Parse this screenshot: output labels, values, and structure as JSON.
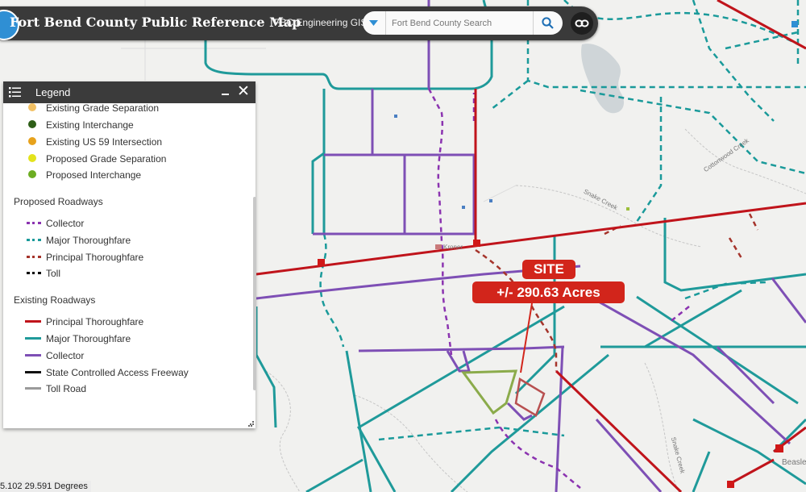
{
  "header": {
    "title": "Fort Bend County Public Reference Map",
    "subtitle": "FBC Engineering GIS",
    "search_placeholder": "Fort Bend County Search"
  },
  "legend": {
    "title": "Legend",
    "point_items": [
      {
        "label": "Existing Grade Separation",
        "color": "#f2c063"
      },
      {
        "label": "Existing Interchange",
        "color": "#2e5e18"
      },
      {
        "label": "Existing US 59 Intersection",
        "color": "#e7a21c"
      },
      {
        "label": "Proposed Grade Separation",
        "color": "#e3e31c"
      },
      {
        "label": "Proposed Interchange",
        "color": "#6cad22"
      }
    ],
    "proposed_heading": "Proposed Roadways",
    "proposed_items": [
      {
        "label": "Collector",
        "color": "#8b33b0"
      },
      {
        "label": "Major Thoroughfare",
        "color": "#1a9a9a"
      },
      {
        "label": "Principal Thoroughfare",
        "color": "#a5342b"
      },
      {
        "label": "Toll",
        "color": "#000000"
      }
    ],
    "existing_heading": "Existing Roadways",
    "existing_items": [
      {
        "label": "Principal Thoroughfare",
        "color": "#c0141b"
      },
      {
        "label": "Major Thoroughfare",
        "color": "#1f9a9a"
      },
      {
        "label": "Collector",
        "color": "#7e4fb5"
      },
      {
        "label": "State Controlled Access Freeway",
        "color": "#111111"
      },
      {
        "label": "Toll Road",
        "color": "#9a9a9a"
      }
    ]
  },
  "coordinates": "5.102 29.591 Degrees",
  "callout": {
    "site": "SITE",
    "acres": "+/- 290.63 Acres",
    "color": "#d2251b"
  },
  "map_labels": {
    "creek_1": "Snake Creek",
    "creek_2": "Cottonwood Creek",
    "creek_3": "Snake Creek",
    "place": "Beasley",
    "small_town": "Kroner"
  }
}
